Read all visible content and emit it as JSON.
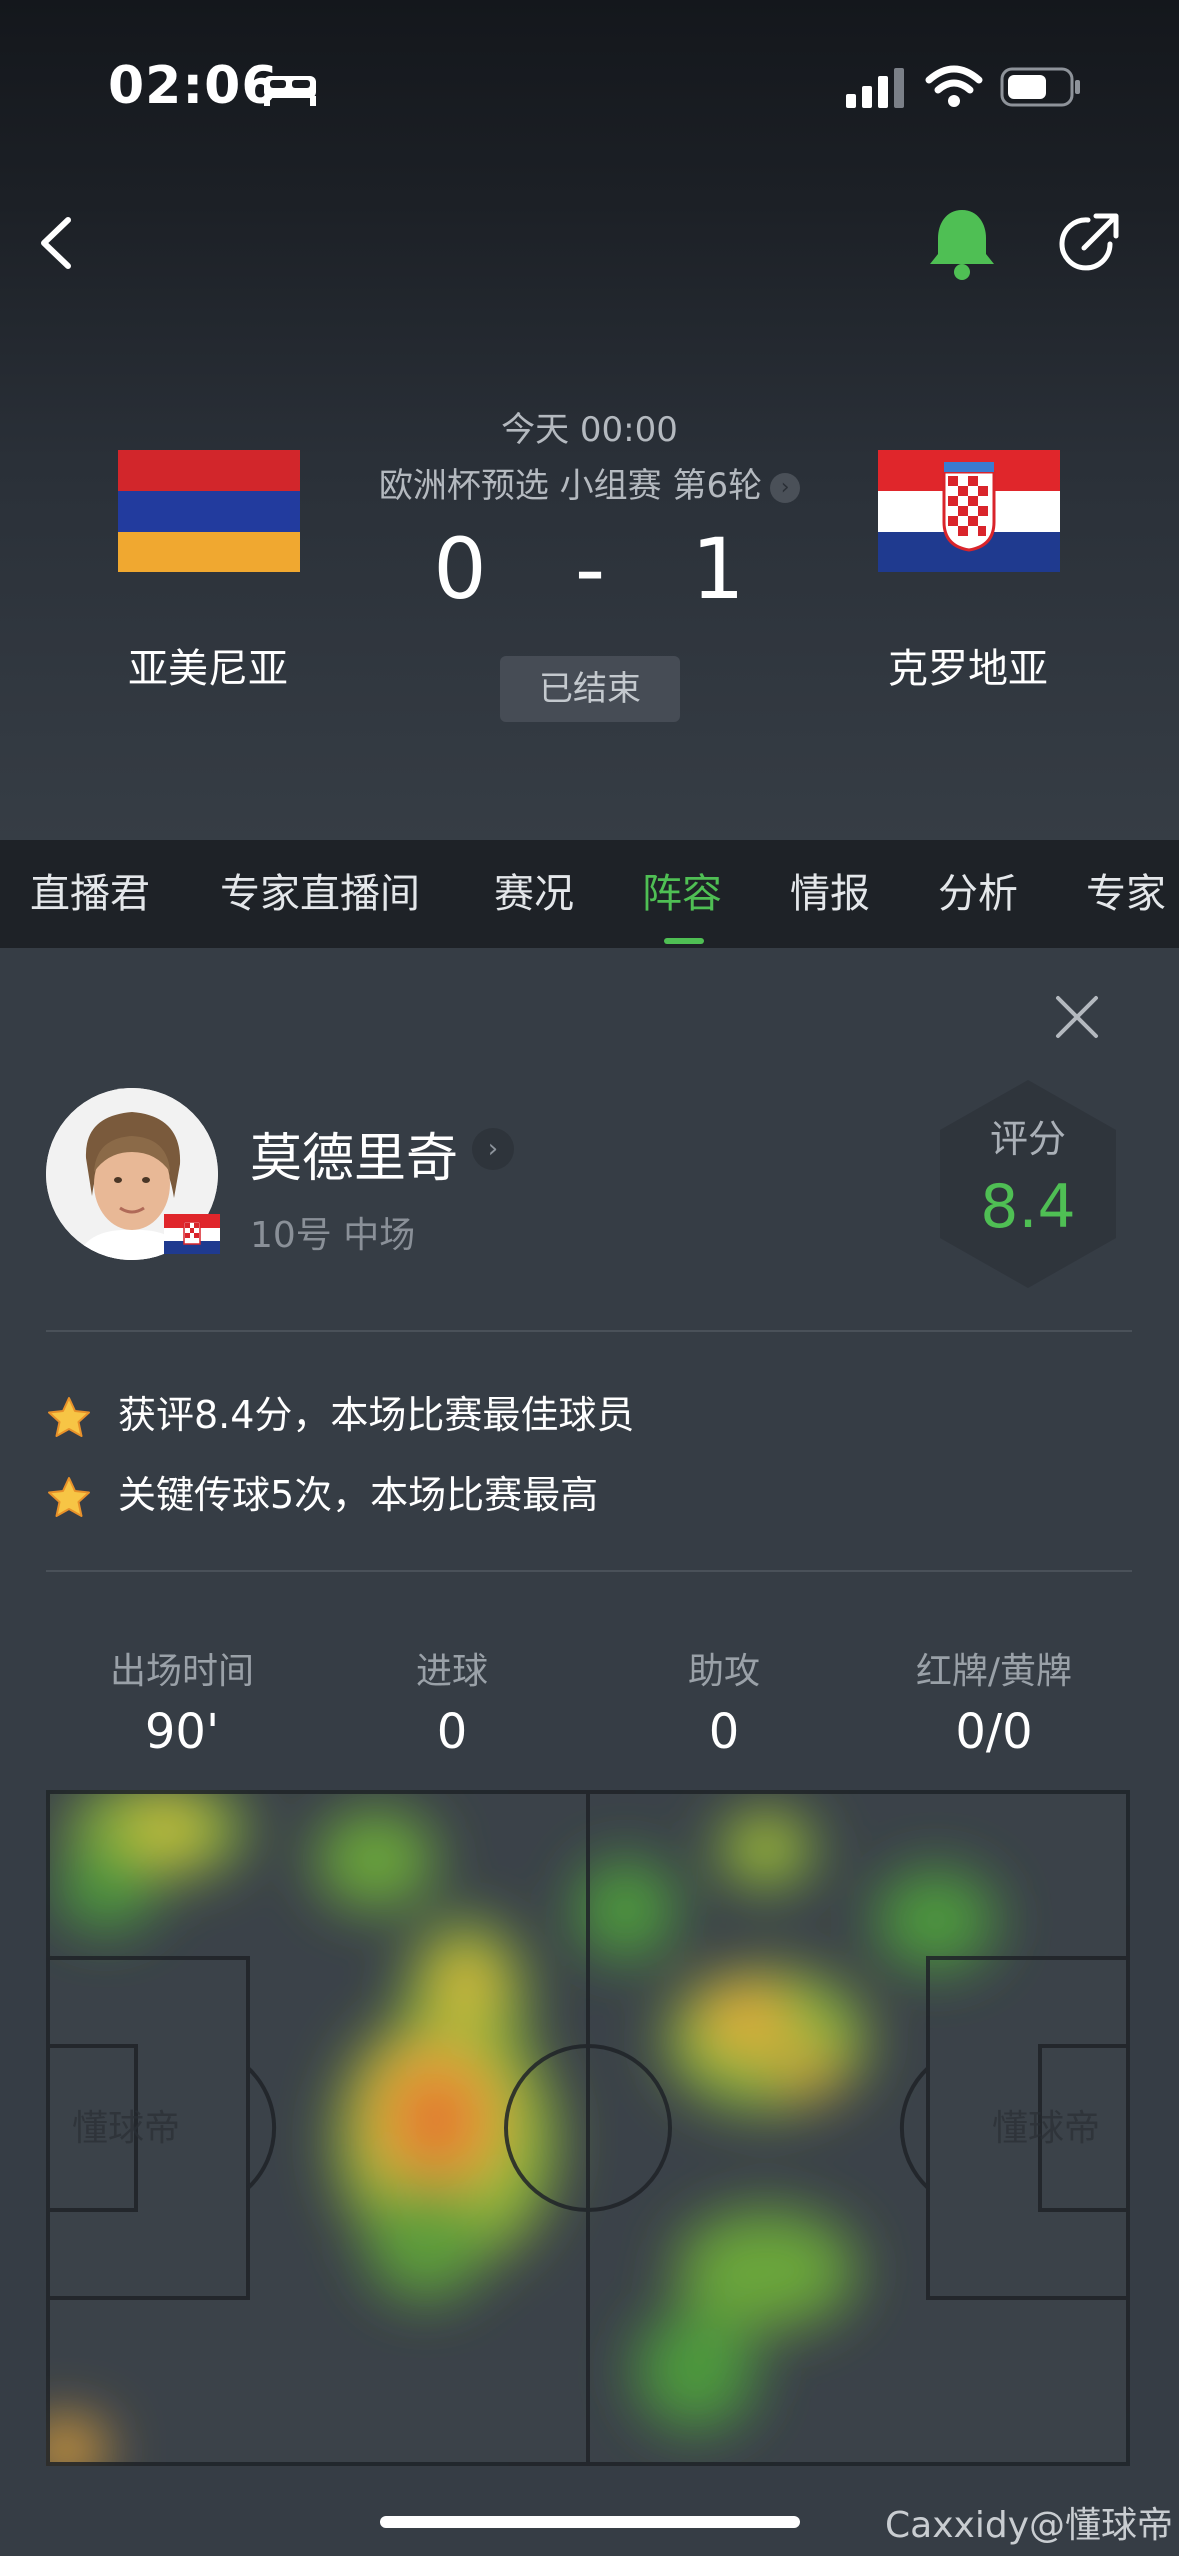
{
  "status_bar": {
    "time": "02:06"
  },
  "match": {
    "kickoff": "今天 00:00",
    "competition": "欧洲杯预选 小组赛 第6轮",
    "home_team": "亚美尼亚",
    "away_team": "克罗地亚",
    "home_score": "0",
    "separator": "-",
    "away_score": "1",
    "status": "已结束"
  },
  "tabs": [
    {
      "label": "直播君"
    },
    {
      "label": "专家直播间"
    },
    {
      "label": "赛况"
    },
    {
      "label": "阵容",
      "active": true
    },
    {
      "label": "情报"
    },
    {
      "label": "分析"
    },
    {
      "label": "专家"
    }
  ],
  "player": {
    "name": "莫德里奇",
    "meta": "10号 中场",
    "rating_label": "评分",
    "rating_value": "8.4"
  },
  "highlights": [
    "获评8.4分，本场比赛最佳球员",
    "关键传球5次，本场比赛最高"
  ],
  "stats": [
    {
      "label": "出场时间",
      "value": "90'"
    },
    {
      "label": "进球",
      "value": "0"
    },
    {
      "label": "助攻",
      "value": "0"
    },
    {
      "label": "红牌/黄牌",
      "value": "0/0"
    }
  ],
  "pitch_watermark": "懂球帝",
  "watermark": "Caxxidy@懂球帝",
  "colors": {
    "accent_green": "#4fbf54",
    "background": "#363d45",
    "tab_bar": "#1e2227"
  },
  "icons": [
    "back-icon",
    "bell-icon",
    "share-icon",
    "close-icon",
    "star-icon",
    "chevron-right-icon"
  ]
}
